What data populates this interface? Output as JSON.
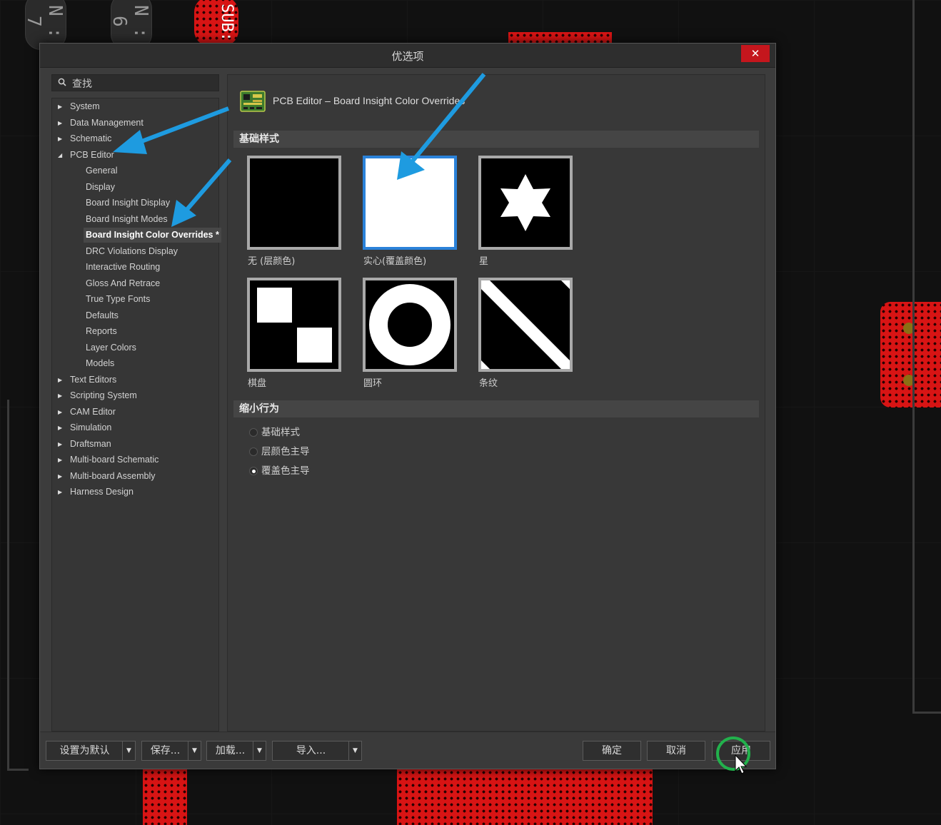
{
  "dialog": {
    "title": "优选项",
    "close_label": "✕"
  },
  "search": {
    "placeholder": "查找"
  },
  "tree": [
    {
      "label": "System",
      "level": 1,
      "arrow": "▶"
    },
    {
      "label": "Data Management",
      "level": 1,
      "arrow": "▶"
    },
    {
      "label": "Schematic",
      "level": 1,
      "arrow": "▶"
    },
    {
      "label": "PCB Editor",
      "level": 1,
      "arrow": "◢"
    },
    {
      "label": "General",
      "level": 2
    },
    {
      "label": "Display",
      "level": 2
    },
    {
      "label": "Board Insight Display",
      "level": 2
    },
    {
      "label": "Board Insight Modes",
      "level": 2
    },
    {
      "label": "Board Insight Color Overrides *",
      "level": 2,
      "selected": true
    },
    {
      "label": "DRC Violations Display",
      "level": 2
    },
    {
      "label": "Interactive Routing",
      "level": 2
    },
    {
      "label": "Gloss And Retrace",
      "level": 2
    },
    {
      "label": "True Type Fonts",
      "level": 2
    },
    {
      "label": "Defaults",
      "level": 2
    },
    {
      "label": "Reports",
      "level": 2
    },
    {
      "label": "Layer Colors",
      "level": 2
    },
    {
      "label": "Models",
      "level": 2
    },
    {
      "label": "Text Editors",
      "level": 1,
      "arrow": "▶"
    },
    {
      "label": "Scripting System",
      "level": 1,
      "arrow": "▶"
    },
    {
      "label": "CAM Editor",
      "level": 1,
      "arrow": "▶"
    },
    {
      "label": "Simulation",
      "level": 1,
      "arrow": "▶"
    },
    {
      "label": "Draftsman",
      "level": 1,
      "arrow": "▶"
    },
    {
      "label": "Multi-board Schematic",
      "level": 1,
      "arrow": "▶"
    },
    {
      "label": "Multi-board Assembly",
      "level": 1,
      "arrow": "▶"
    },
    {
      "label": "Harness Design",
      "level": 1,
      "arrow": "▶"
    }
  ],
  "page": {
    "title": "PCB Editor – Board Insight Color Overrides",
    "base_section": "基础样式",
    "tiles": [
      {
        "label": "无 (层颜色)",
        "pattern": "none"
      },
      {
        "label": "实心(覆盖颜色)",
        "pattern": "solid",
        "selected": true
      },
      {
        "label": "星",
        "pattern": "star"
      },
      {
        "label": "棋盘",
        "pattern": "checker"
      },
      {
        "label": "圆环",
        "pattern": "ring"
      },
      {
        "label": "条纹",
        "pattern": "stripe"
      }
    ],
    "zoom_section": "缩小行为",
    "radios": [
      {
        "label": "基础样式",
        "checked": false
      },
      {
        "label": "层颜色主导",
        "checked": false
      },
      {
        "label": "覆盖色主导",
        "checked": true
      }
    ]
  },
  "footer": {
    "set_default": "设置为默认",
    "save": "保存...",
    "load": "加载...",
    "import": "导入...",
    "ok": "确定",
    "cancel": "取消",
    "apply": "应用",
    "dropdown_glyph": "▼"
  },
  "background": {
    "silkscreen_text": "SUB:"
  },
  "colors": {
    "accent": "#2b82d9",
    "close": "#c4161d",
    "annotation_arrow": "#1e9be0",
    "highlight_circle": "#22b14c",
    "pcb_pad": "#d81414"
  }
}
